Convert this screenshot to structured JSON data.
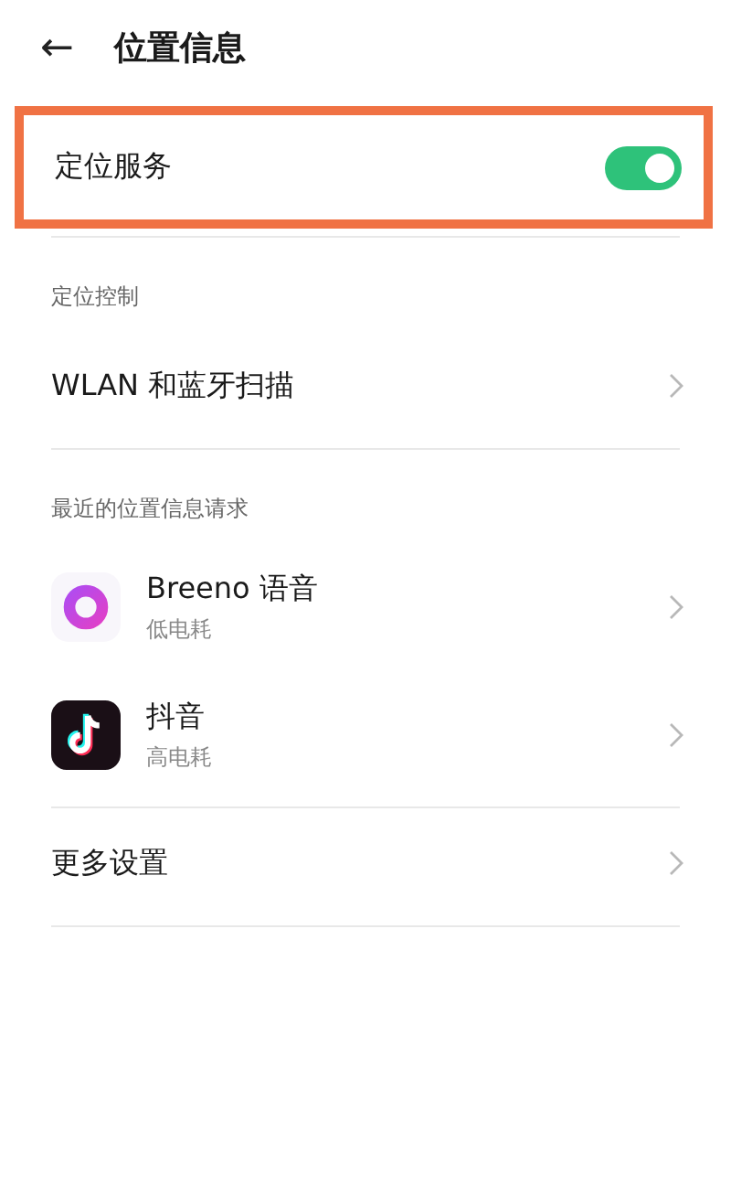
{
  "header": {
    "back": "←",
    "title": "位置信息"
  },
  "location_service": {
    "label": "定位服务",
    "on": true,
    "highlighted": true
  },
  "sections": [
    {
      "heading": "定位控制",
      "items": [
        {
          "kind": "plain",
          "label": "WLAN 和蓝牙扫描"
        }
      ]
    },
    {
      "heading": "最近的位置信息请求",
      "items": [
        {
          "kind": "app",
          "label": "Breeno 语音",
          "sub": "低电耗"
        },
        {
          "kind": "app",
          "label": "抖音",
          "sub": "高电耗"
        }
      ]
    },
    {
      "items": [
        {
          "kind": "plain",
          "label": "更多设置"
        }
      ]
    }
  ]
}
